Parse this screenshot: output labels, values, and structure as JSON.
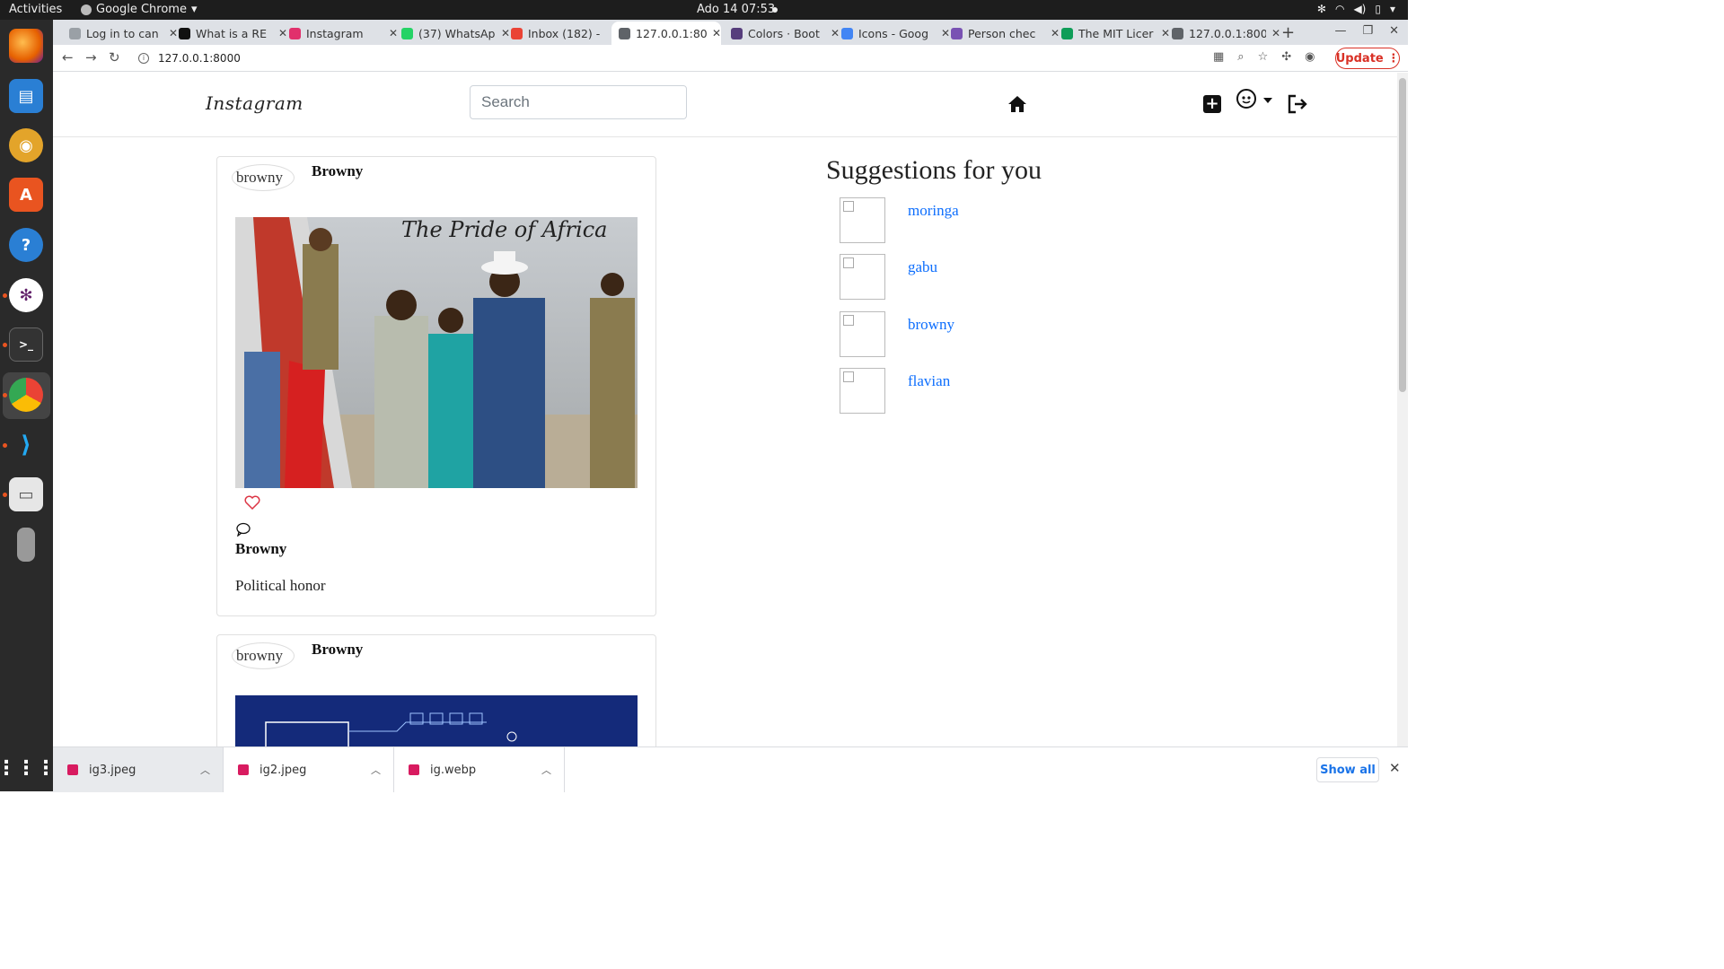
{
  "os": {
    "activities": "Activities",
    "app_name": "Google Chrome",
    "clock": "Ado 14  07:53"
  },
  "tabs": [
    {
      "title": "Log in to can",
      "color": "#9aa0a6"
    },
    {
      "title": "What is a RE",
      "color": "#111111"
    },
    {
      "title": "Instagram",
      "color": "#e1306c"
    },
    {
      "title": "(37) WhatsAp",
      "color": "#25d366"
    },
    {
      "title": "Inbox (182) -",
      "color": "#ea4335"
    },
    {
      "title": "127.0.0.1:800",
      "color": "#5f6368",
      "active": true
    },
    {
      "title": "Colors · Boot",
      "color": "#563d7c"
    },
    {
      "title": "Icons - Goog",
      "color": "#4285f4"
    },
    {
      "title": "Person chec",
      "color": "#7952b3"
    },
    {
      "title": "The MIT Licer",
      "color": "#0f9d58"
    },
    {
      "title": "127.0.0.1:800",
      "color": "#5f6368"
    }
  ],
  "address": {
    "url": "127.0.0.1:8000",
    "update_label": "Update"
  },
  "navbar": {
    "brand": "Instagram",
    "search_placeholder": "Search"
  },
  "posts": [
    {
      "username": "Browny",
      "avatar_alt": "browny",
      "author": "Browny",
      "caption": "Political honor",
      "photo_text": "The Pride of Africa"
    },
    {
      "username": "Browny",
      "avatar_alt": "browny"
    }
  ],
  "suggestions": {
    "title": "Suggestions for you",
    "users": [
      "moringa",
      "gabu",
      "browny",
      "flavian"
    ]
  },
  "downloads": {
    "items": [
      "ig3.jpeg",
      "ig2.jpeg",
      "ig.webp"
    ],
    "show_all": "Show all"
  },
  "colors": {
    "link": "#0d6efd",
    "heart": "#dc3545",
    "update": "#d93025"
  }
}
